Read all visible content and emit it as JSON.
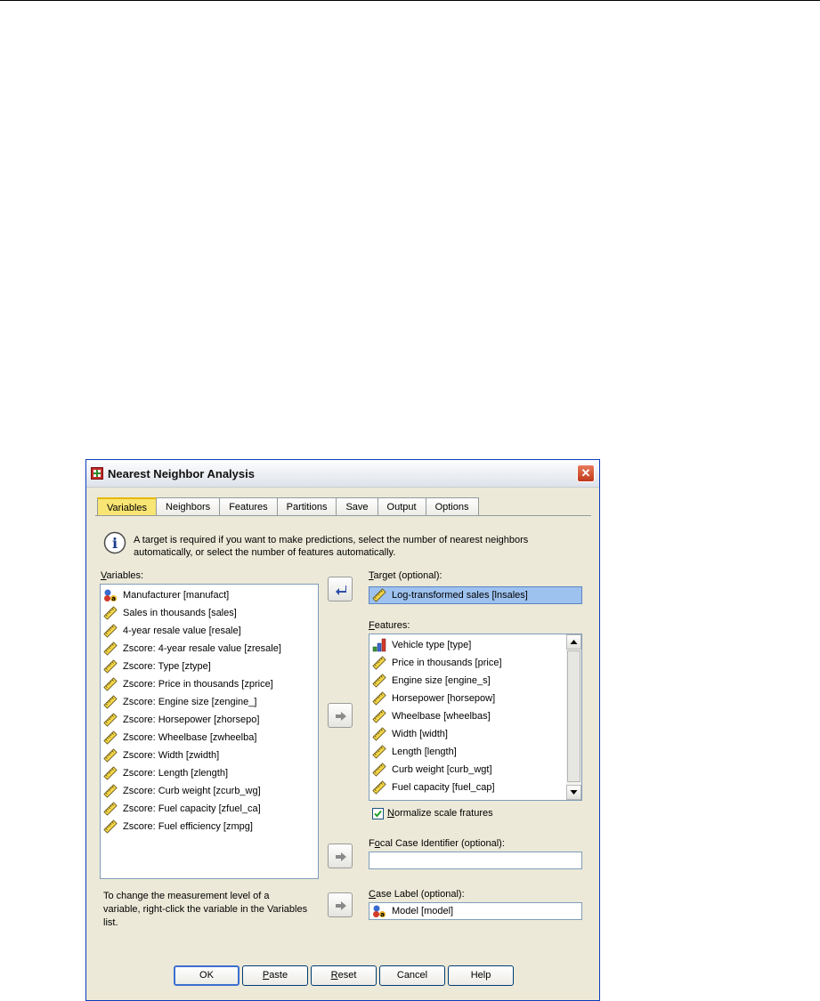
{
  "window": {
    "title": "Nearest Neighbor Analysis"
  },
  "tabs": [
    "Variables",
    "Neighbors",
    "Features",
    "Partitions",
    "Save",
    "Output",
    "Options"
  ],
  "info_text": "A target is required if you want to make predictions, select the number of nearest neighbors automatically, or select the number of features automatically.",
  "variables_panel": {
    "label_prefix": "",
    "label_mnemonic": "V",
    "label_rest": "ariables:",
    "items": [
      {
        "label": "Manufacturer [manufact]",
        "icon": "nominal-icon"
      },
      {
        "label": "Sales in thousands [sales]",
        "icon": "scale-icon"
      },
      {
        "label": "4-year resale value [resale]",
        "icon": "scale-icon"
      },
      {
        "label": "Zscore:  4-year resale value [zresale]",
        "icon": "scale-icon"
      },
      {
        "label": "Zscore:  Type [ztype]",
        "icon": "scale-icon"
      },
      {
        "label": "Zscore:  Price in thousands [zprice]",
        "icon": "scale-icon"
      },
      {
        "label": "Zscore:  Engine size [zengine_]",
        "icon": "scale-icon"
      },
      {
        "label": "Zscore:  Horsepower [zhorsepo]",
        "icon": "scale-icon"
      },
      {
        "label": "Zscore:  Wheelbase [zwheelba]",
        "icon": "scale-icon"
      },
      {
        "label": "Zscore:  Width [zwidth]",
        "icon": "scale-icon"
      },
      {
        "label": "Zscore:  Length [zlength]",
        "icon": "scale-icon"
      },
      {
        "label": "Zscore:  Curb weight [zcurb_wg]",
        "icon": "scale-icon"
      },
      {
        "label": "Zscore:  Fuel capacity [zfuel_ca]",
        "icon": "scale-icon"
      },
      {
        "label": "Zscore:  Fuel efficiency [zmpg]",
        "icon": "scale-icon"
      }
    ]
  },
  "target": {
    "label_prefix": "",
    "label_mnemonic": "T",
    "label_rest": "arget (optional):",
    "value": "Log-transformed sales [lnsales]",
    "icon": "scale-icon"
  },
  "features": {
    "label_prefix": "",
    "label_mnemonic": "F",
    "label_rest": "eatures:",
    "items": [
      {
        "label": "Vehicle type [type]",
        "icon": "ordinal-icon"
      },
      {
        "label": "Price in thousands [price]",
        "icon": "scale-icon"
      },
      {
        "label": "Engine size [engine_s]",
        "icon": "scale-icon"
      },
      {
        "label": "Horsepower [horsepow]",
        "icon": "scale-icon"
      },
      {
        "label": "Wheelbase [wheelbas]",
        "icon": "scale-icon"
      },
      {
        "label": "Width [width]",
        "icon": "scale-icon"
      },
      {
        "label": "Length [length]",
        "icon": "scale-icon"
      },
      {
        "label": "Curb weight [curb_wgt]",
        "icon": "scale-icon"
      },
      {
        "label": "Fuel capacity [fuel_cap]",
        "icon": "scale-icon"
      }
    ]
  },
  "normalize": {
    "checked": true,
    "label_prefix": "",
    "label_mnemonic": "N",
    "label_rest": "ormalize scale fratures"
  },
  "focal": {
    "label_prefix": "F",
    "label_mnemonic": "o",
    "label_rest": "cal Case Identifier (optional):",
    "value": ""
  },
  "case_label": {
    "label_prefix": "",
    "label_mnemonic": "C",
    "label_rest": "ase Label (optional):",
    "value": "Model [model]",
    "icon": "nominal-icon"
  },
  "note": "To change the measurement level of a variable, right-click the variable in the Variables list.",
  "buttons": {
    "ok": "OK",
    "paste_m": "P",
    "paste_r": "aste",
    "reset_m": "R",
    "reset_r": "eset",
    "cancel": "Cancel",
    "help": "Help"
  },
  "colors": {
    "tab_active": "#f8e573",
    "selection": "#9ec2ef",
    "close_button": "#c0391b"
  }
}
